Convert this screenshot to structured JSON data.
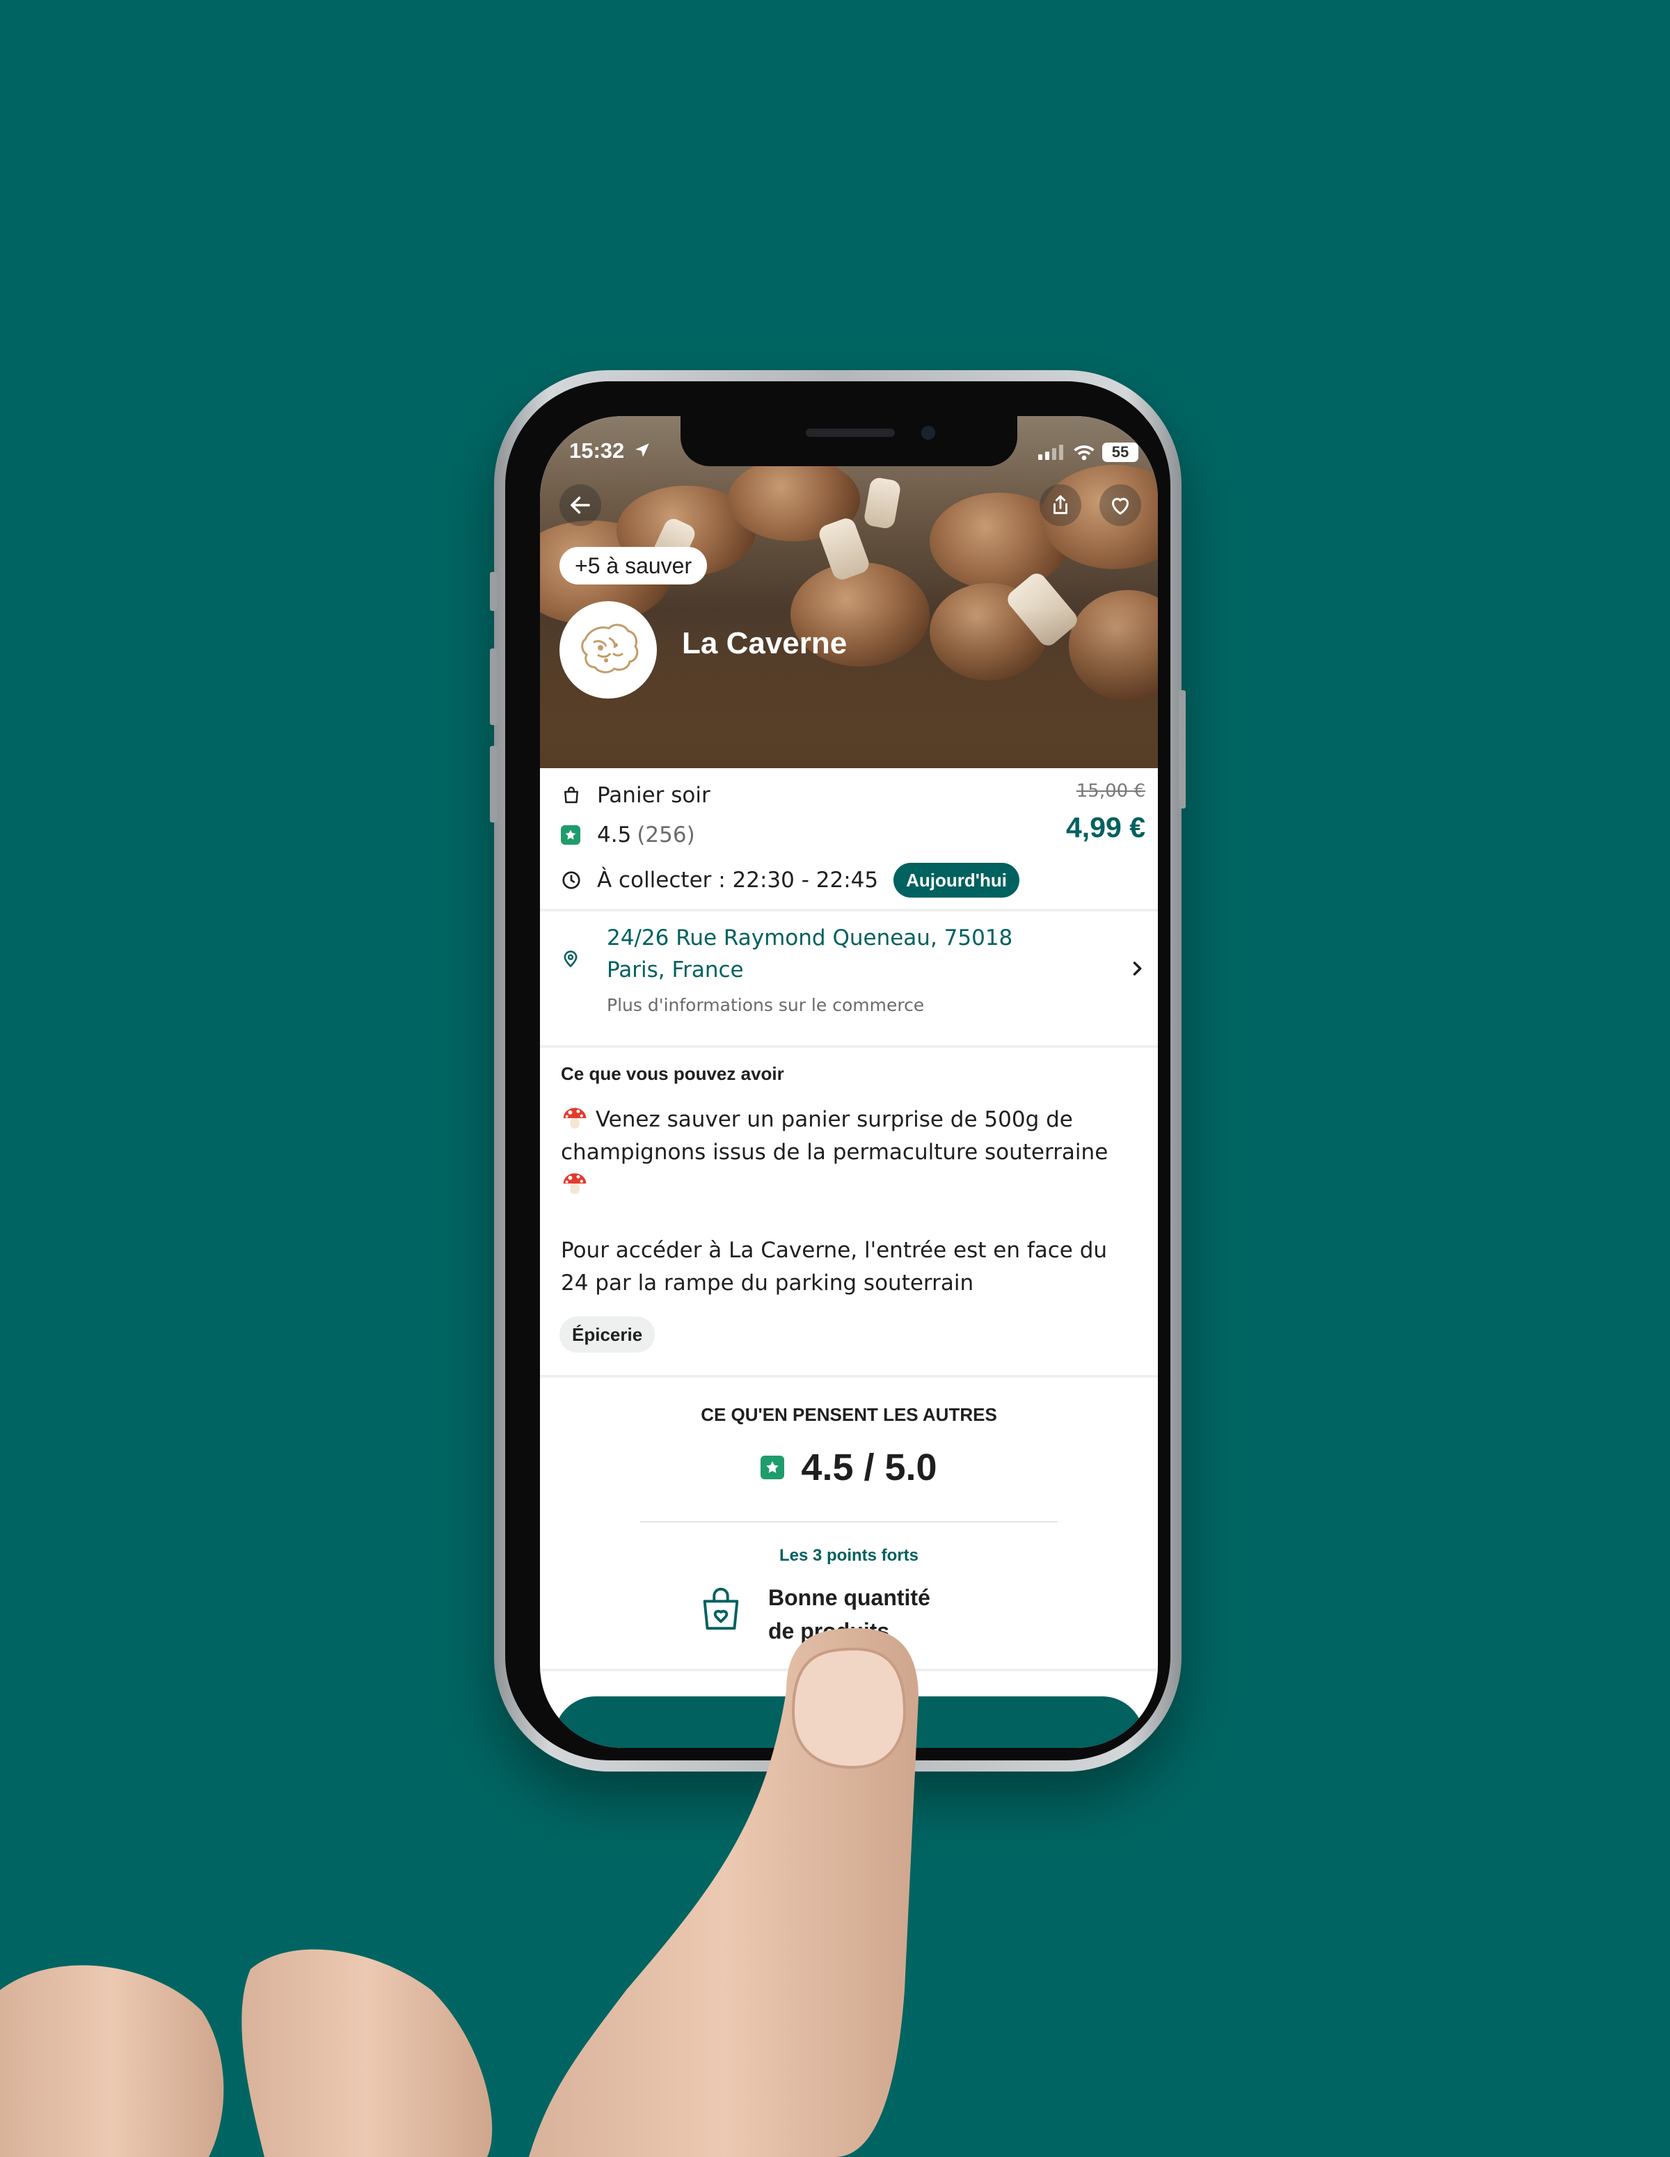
{
  "status_bar": {
    "time": "15:32",
    "battery": "55"
  },
  "hero": {
    "badge": "+5 à sauver",
    "store_name": "La Caverne"
  },
  "offer": {
    "bag_type": "Panier soir",
    "rating": "4.5",
    "rating_count": "(256)",
    "collect_label": "À collecter : 22:30 - 22:45",
    "today_badge": "Aujourd'hui",
    "original_price": "15,00 €",
    "price": "4,99 €"
  },
  "address": {
    "line1": "24/26 Rue Raymond Queneau, 75018",
    "line2": "Paris, France",
    "more_info": "Plus d'informations sur le commerce"
  },
  "description": {
    "heading": "Ce que vous pouvez avoir",
    "para1_line1": "Venez sauver un panier surprise de 500g de",
    "para1_line2": "champignons issus de la permaculture souterraine",
    "para2_line1": "Pour accéder à La Caverne, l'entrée est en face du",
    "para2_line2": "24 par la rampe du parking souterrain",
    "tag": "Épicerie"
  },
  "reviews": {
    "heading": "CE QU'EN PENSENT LES AUTRES",
    "score": "4.5 / 5.0",
    "highlights_title": "Les 3 points forts",
    "highlight1_line1": "Bonne quantité",
    "highlight1_line2": "de produits"
  },
  "colors": {
    "background": "#006562",
    "brand": "#00615e",
    "star": "#1f9c6c"
  },
  "icons": [
    "back-arrow-icon",
    "share-icon",
    "heart-icon",
    "bag-icon",
    "star-icon",
    "clock-icon",
    "location-pin-icon",
    "chevron-right-icon",
    "mushroom-icon",
    "shopping-bag-icon"
  ]
}
